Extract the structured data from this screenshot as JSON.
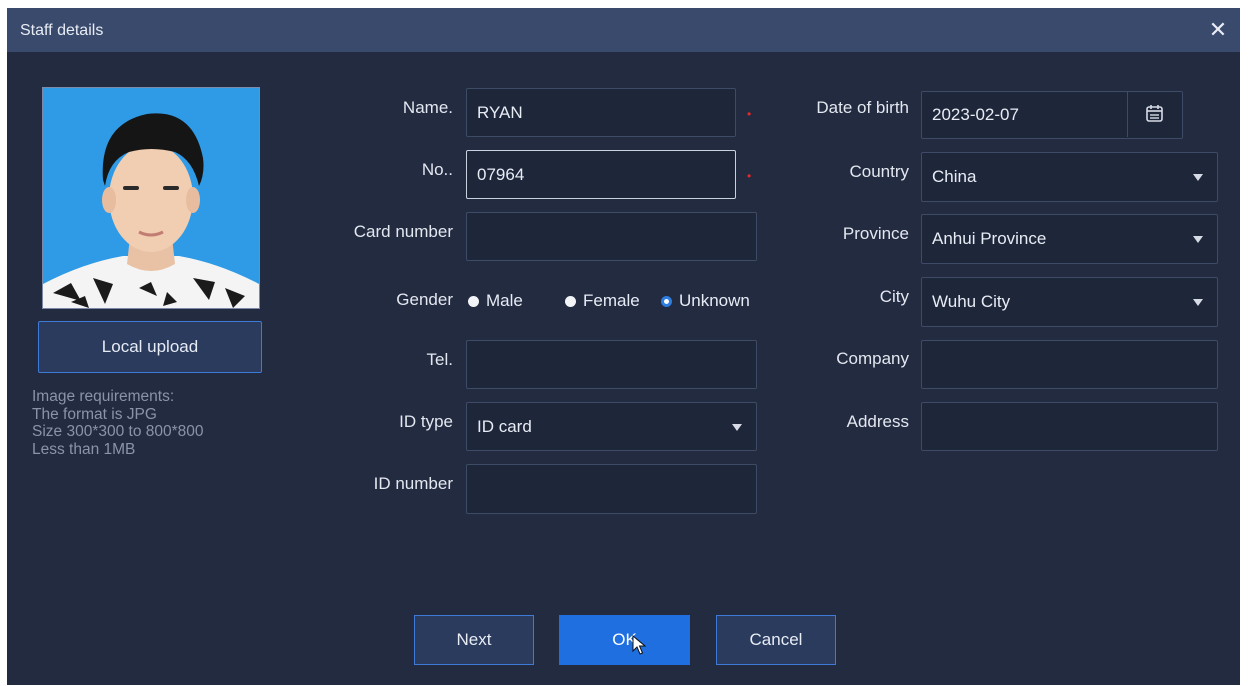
{
  "dialog": {
    "title": "Staff details",
    "close_glyph": "✕"
  },
  "photo": {
    "alt": "Staff photo"
  },
  "upload": {
    "label": "Local upload"
  },
  "requirements": [
    "Image requirements:",
    "The format is JPG",
    "Size 300*300 to 800*800",
    "Less than 1MB"
  ],
  "form_left": {
    "name": {
      "label": "Name.",
      "value": "RYAN",
      "required": "•"
    },
    "no": {
      "label": "No..",
      "value": "07964",
      "required": "•"
    },
    "card_number": {
      "label": "Card number",
      "value": ""
    },
    "gender": {
      "label": "Gender",
      "options": [
        "Male",
        "Female",
        "Unknown"
      ],
      "selected": "Unknown"
    },
    "tel": {
      "label": "Tel.",
      "value": ""
    },
    "id_type": {
      "label": "ID type",
      "value": "ID card"
    },
    "id_number": {
      "label": "ID number",
      "value": ""
    }
  },
  "form_right": {
    "dob": {
      "label": "Date of birth",
      "value": "2023-02-07"
    },
    "country": {
      "label": "Country",
      "value": "China"
    },
    "province": {
      "label": "Province",
      "value": "Anhui Province"
    },
    "city": {
      "label": "City",
      "value": "Wuhu City"
    },
    "company": {
      "label": "Company",
      "value": ""
    },
    "address": {
      "label": "Address",
      "value": ""
    }
  },
  "buttons": {
    "next": "Next",
    "ok": "OK",
    "cancel": "Cancel"
  },
  "colors": {
    "background": "#232b41",
    "titlebar": "#3a4a6c",
    "accent": "#1f6fe0",
    "required": "#e02b2b"
  },
  "icons": {
    "close": "close-icon",
    "calendar": "calendar-icon",
    "dropdown": "chevron-down-icon",
    "cursor": "mouse-cursor-icon"
  }
}
